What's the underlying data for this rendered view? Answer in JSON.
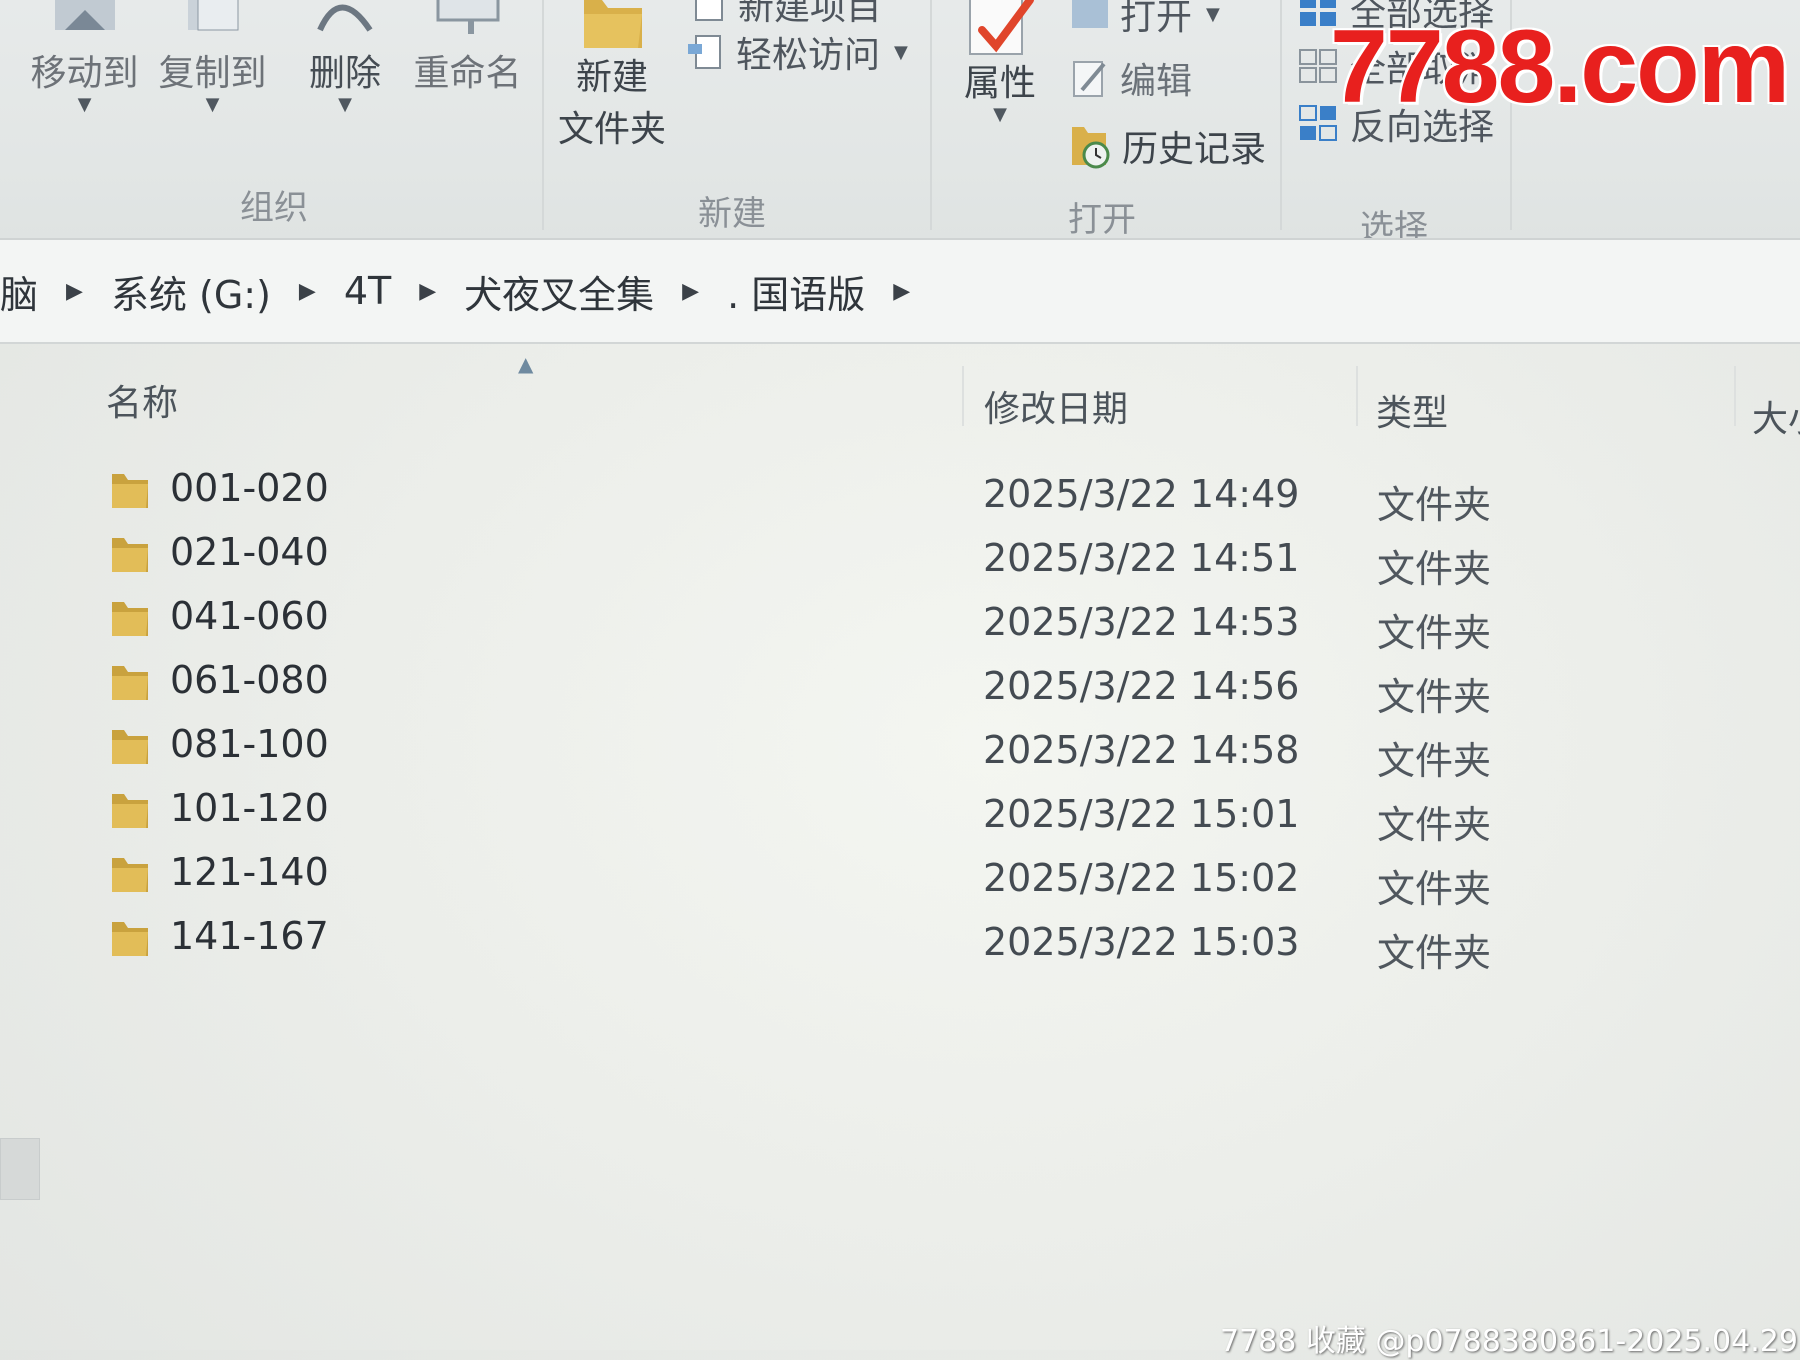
{
  "ribbon": {
    "organize": {
      "move_to": "移动到",
      "copy_to": "复制到",
      "delete": "删除",
      "rename": "重命名",
      "group": "组织"
    },
    "new": {
      "new_folder_line1": "新建",
      "new_folder_line2": "文件夹",
      "new_item": "新建项目",
      "easy_access": "轻松访问",
      "group": "新建"
    },
    "open": {
      "properties": "属性",
      "open": "打开",
      "edit": "编辑",
      "history": "历史记录",
      "group": "打开"
    },
    "select": {
      "select_all": "全部选择",
      "select_none": "全部取消",
      "invert": "反向选择",
      "group": "选择"
    }
  },
  "address": {
    "crumbs": [
      "脑",
      "系统 (G:)",
      "4T",
      "犬夜叉全集",
      ". 国语版"
    ]
  },
  "columns": {
    "name": "名称",
    "modified": "修改日期",
    "type": "类型",
    "size": "大小"
  },
  "files": [
    {
      "name": "001-020",
      "modified": "2025/3/22 14:49",
      "type": "文件夹"
    },
    {
      "name": "021-040",
      "modified": "2025/3/22 14:51",
      "type": "文件夹"
    },
    {
      "name": "041-060",
      "modified": "2025/3/22 14:53",
      "type": "文件夹"
    },
    {
      "name": "061-080",
      "modified": "2025/3/22 14:56",
      "type": "文件夹"
    },
    {
      "name": "081-100",
      "modified": "2025/3/22 14:58",
      "type": "文件夹"
    },
    {
      "name": "101-120",
      "modified": "2025/3/22 15:01",
      "type": "文件夹"
    },
    {
      "name": "121-140",
      "modified": "2025/3/22 15:02",
      "type": "文件夹"
    },
    {
      "name": "141-167",
      "modified": "2025/3/22 15:03",
      "type": "文件夹"
    }
  ],
  "watermarks": {
    "logo": "7788.com",
    "footer": "7788 收藏 @p0788380861-2025.04.29"
  },
  "colors": {
    "folder": "#d9b04a",
    "logo_red": "#e8201e",
    "ribbon_bg": "#e4e8e7"
  }
}
